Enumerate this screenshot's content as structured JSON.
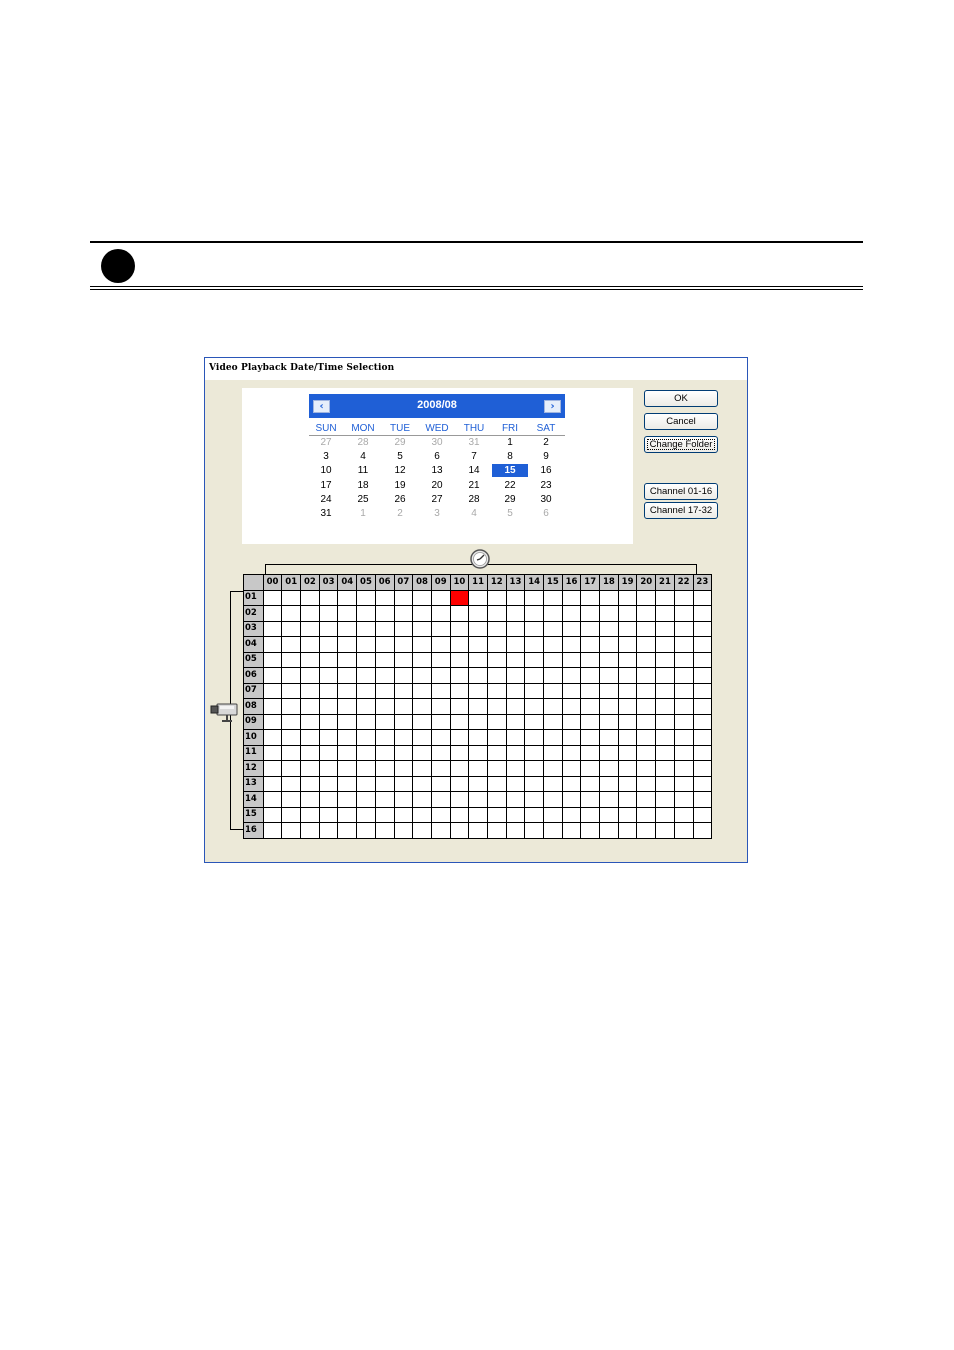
{
  "dialog": {
    "title": "Video Playback Date/Time Selection"
  },
  "calendar": {
    "month_label": "2008/08",
    "prev_icon": "chevron-left-icon",
    "next_icon": "chevron-right-icon",
    "weekdays": [
      "SUN",
      "MON",
      "TUE",
      "WED",
      "THU",
      "FRI",
      "SAT"
    ],
    "weeks": [
      [
        {
          "d": "27",
          "o": true
        },
        {
          "d": "28",
          "o": true
        },
        {
          "d": "29",
          "o": true
        },
        {
          "d": "30",
          "o": true
        },
        {
          "d": "31",
          "o": true
        },
        {
          "d": "1"
        },
        {
          "d": "2"
        }
      ],
      [
        {
          "d": "3"
        },
        {
          "d": "4"
        },
        {
          "d": "5"
        },
        {
          "d": "6"
        },
        {
          "d": "7"
        },
        {
          "d": "8"
        },
        {
          "d": "9"
        }
      ],
      [
        {
          "d": "10"
        },
        {
          "d": "11"
        },
        {
          "d": "12"
        },
        {
          "d": "13"
        },
        {
          "d": "14"
        },
        {
          "d": "15",
          "sel": true
        },
        {
          "d": "16"
        }
      ],
      [
        {
          "d": "17"
        },
        {
          "d": "18"
        },
        {
          "d": "19"
        },
        {
          "d": "20"
        },
        {
          "d": "21"
        },
        {
          "d": "22"
        },
        {
          "d": "23"
        }
      ],
      [
        {
          "d": "24"
        },
        {
          "d": "25"
        },
        {
          "d": "26"
        },
        {
          "d": "27"
        },
        {
          "d": "28"
        },
        {
          "d": "29"
        },
        {
          "d": "30"
        }
      ],
      [
        {
          "d": "31"
        },
        {
          "d": "1",
          "o": true
        },
        {
          "d": "2",
          "o": true
        },
        {
          "d": "3",
          "o": true
        },
        {
          "d": "4",
          "o": true
        },
        {
          "d": "5",
          "o": true
        },
        {
          "d": "6",
          "o": true
        }
      ]
    ],
    "selected_color": "#1f5fd6"
  },
  "buttons": {
    "ok": "OK",
    "cancel": "Cancel",
    "change_folder": "Change Folder",
    "channel_1": "Channel 01-16",
    "channel_2": "Channel 17-32"
  },
  "schedule": {
    "hours": [
      "00",
      "01",
      "02",
      "03",
      "04",
      "05",
      "06",
      "07",
      "08",
      "09",
      "10",
      "11",
      "12",
      "13",
      "14",
      "15",
      "16",
      "17",
      "18",
      "19",
      "20",
      "21",
      "22",
      "23"
    ],
    "channels": [
      "01",
      "02",
      "03",
      "04",
      "05",
      "06",
      "07",
      "08",
      "09",
      "10",
      "11",
      "12",
      "13",
      "14",
      "15",
      "16"
    ],
    "recorded": [
      {
        "channel": "01",
        "hour": "10"
      }
    ],
    "recorded_color": "#ff0000",
    "hour_axis_icon": "clock-icon",
    "channel_axis_icon": "camera-icon"
  }
}
